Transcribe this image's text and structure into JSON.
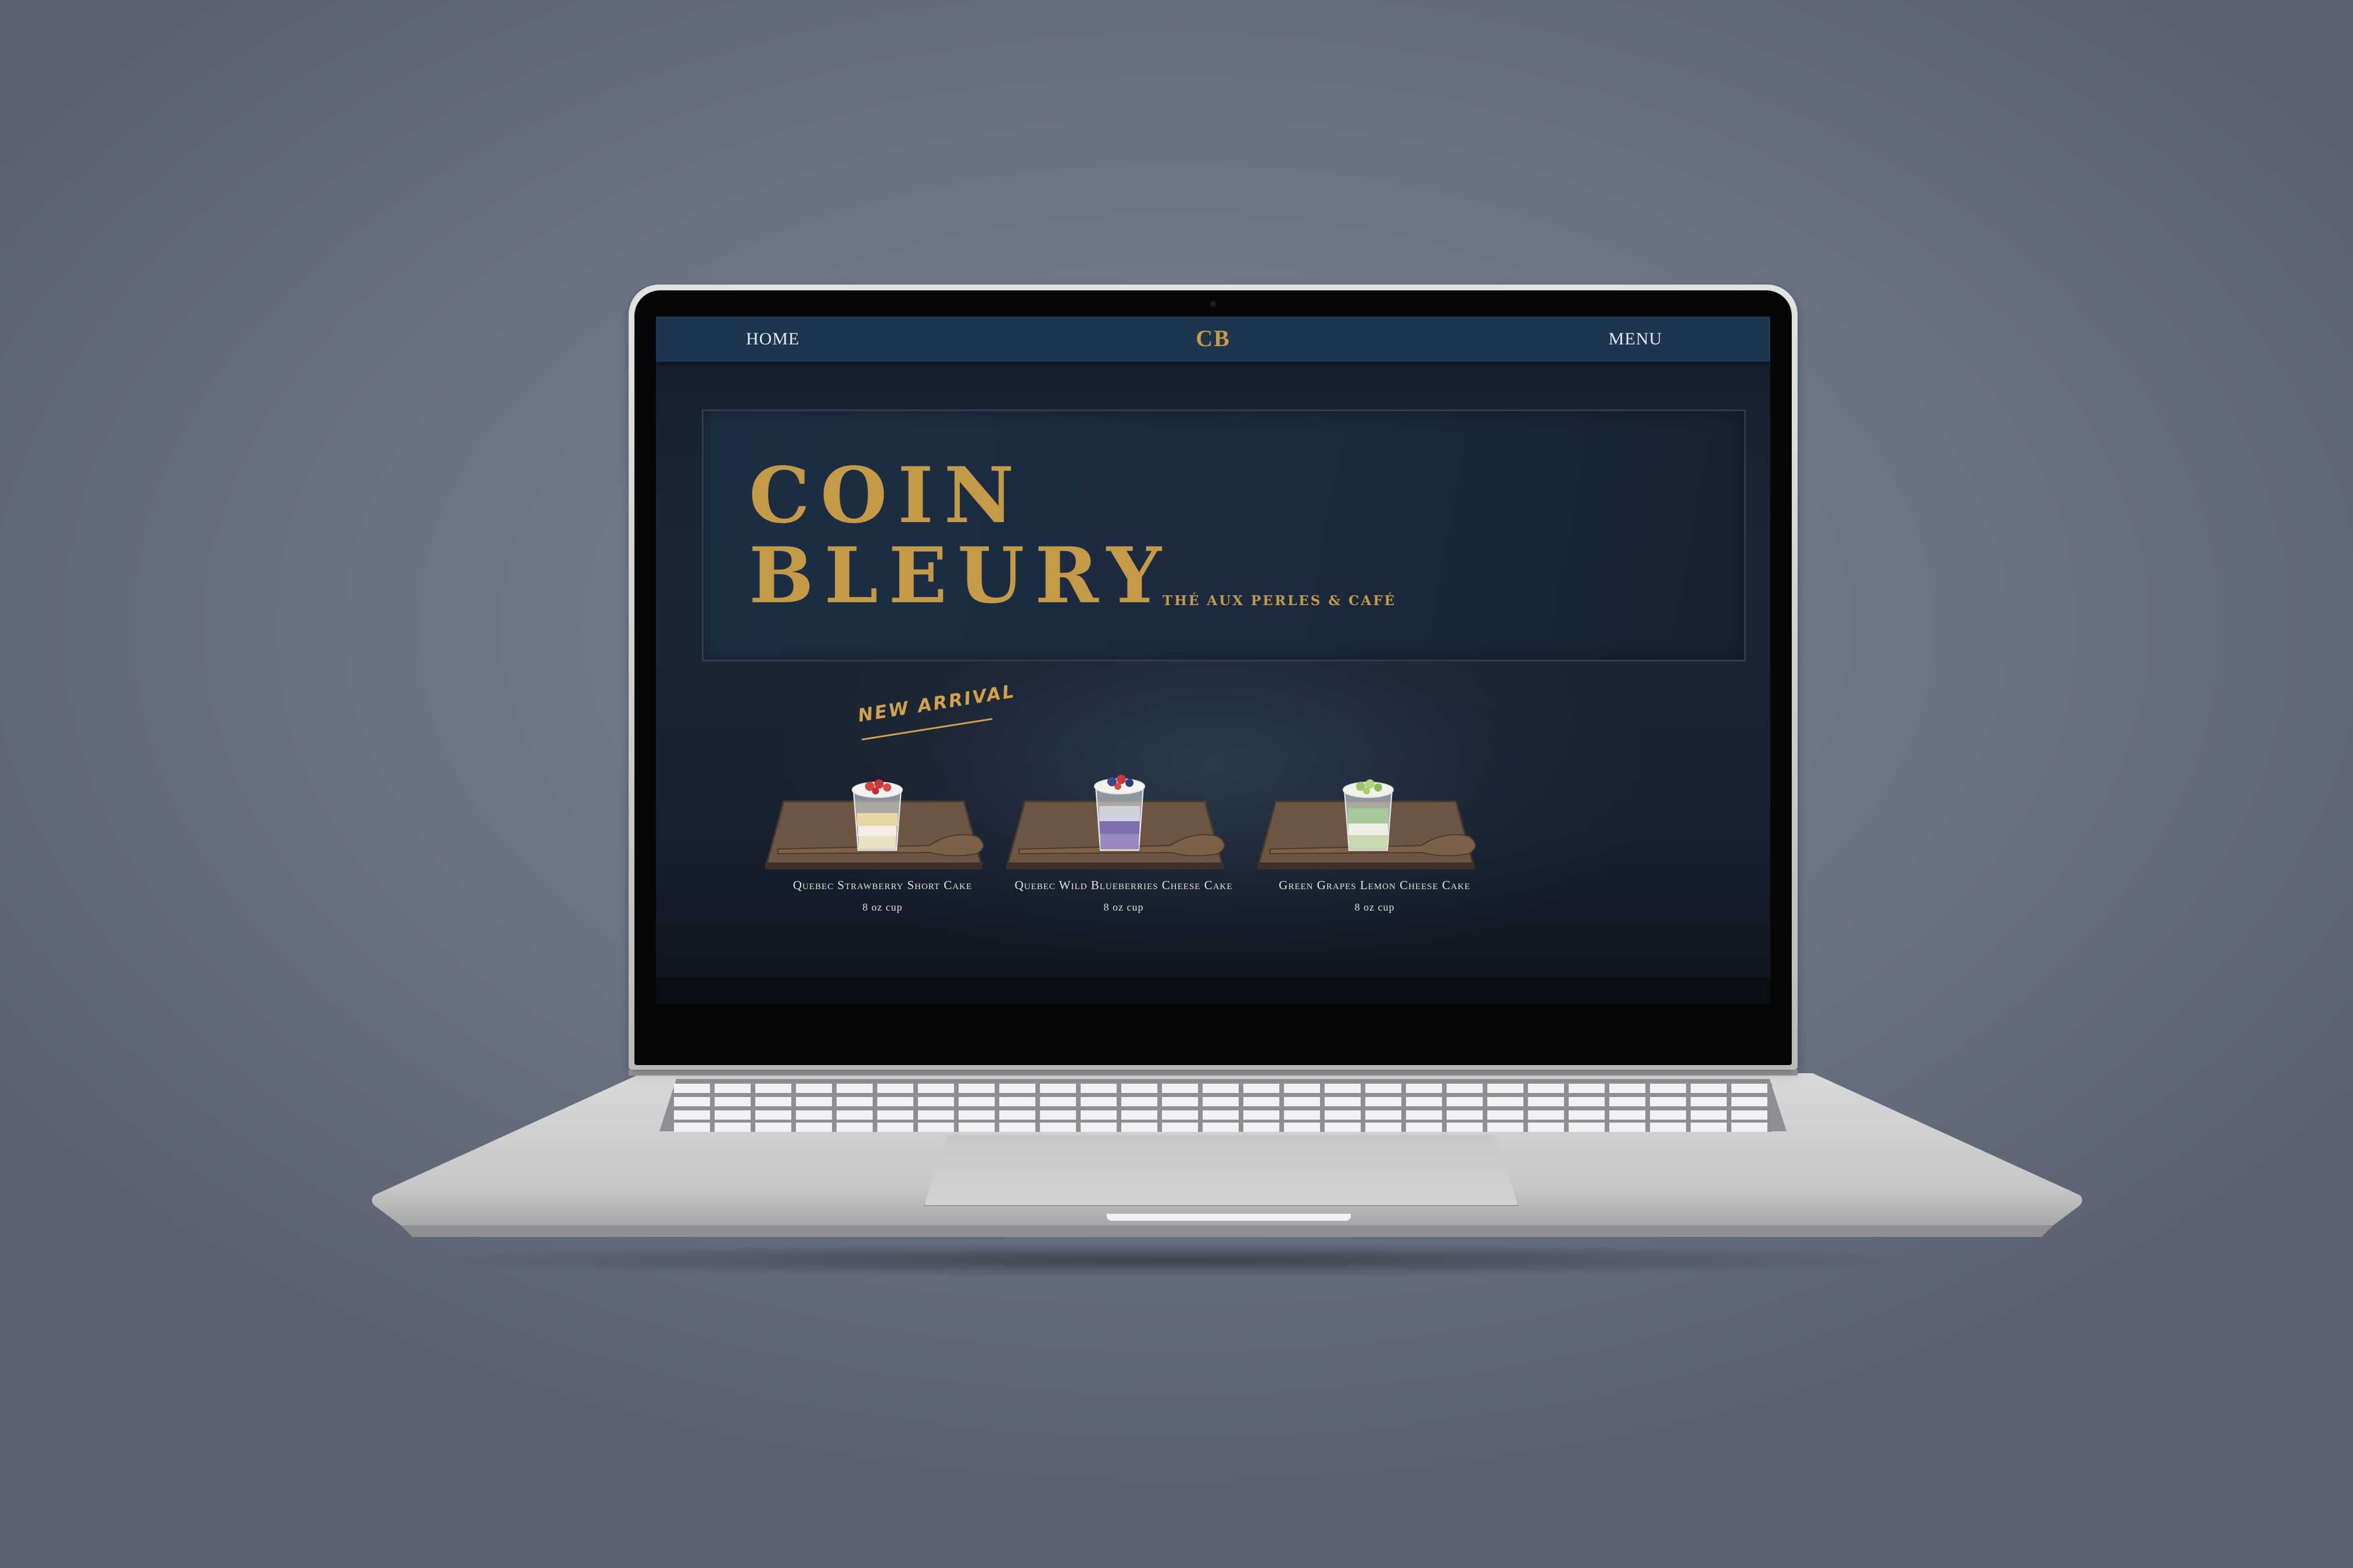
{
  "nav": {
    "home_label": "HOME",
    "logo": "CB",
    "menu_label": "MENU"
  },
  "hero": {
    "title_line_1": "COIN",
    "title_line_2": "BLEURY",
    "tagline": "THÉ AUX PERLES & CAFÉ"
  },
  "badge": "NEW ARRIVAL",
  "products": [
    {
      "name": "Quebec Strawberry Short Cake",
      "size": "8 oz cup",
      "topping": "strawberry"
    },
    {
      "name": "Quebec Wild Blueberries Cheese Cake",
      "size": "8 oz cup",
      "topping": "blueberry"
    },
    {
      "name": "Green Grapes Lemon Cheese Cake",
      "size": "8 oz cup",
      "topping": "green-grape"
    }
  ],
  "colors": {
    "gold": "#c39a47",
    "nav_bg": "#1d3550",
    "page_bg": "#1b2634",
    "laptop_silver": "#c9c9c9"
  }
}
